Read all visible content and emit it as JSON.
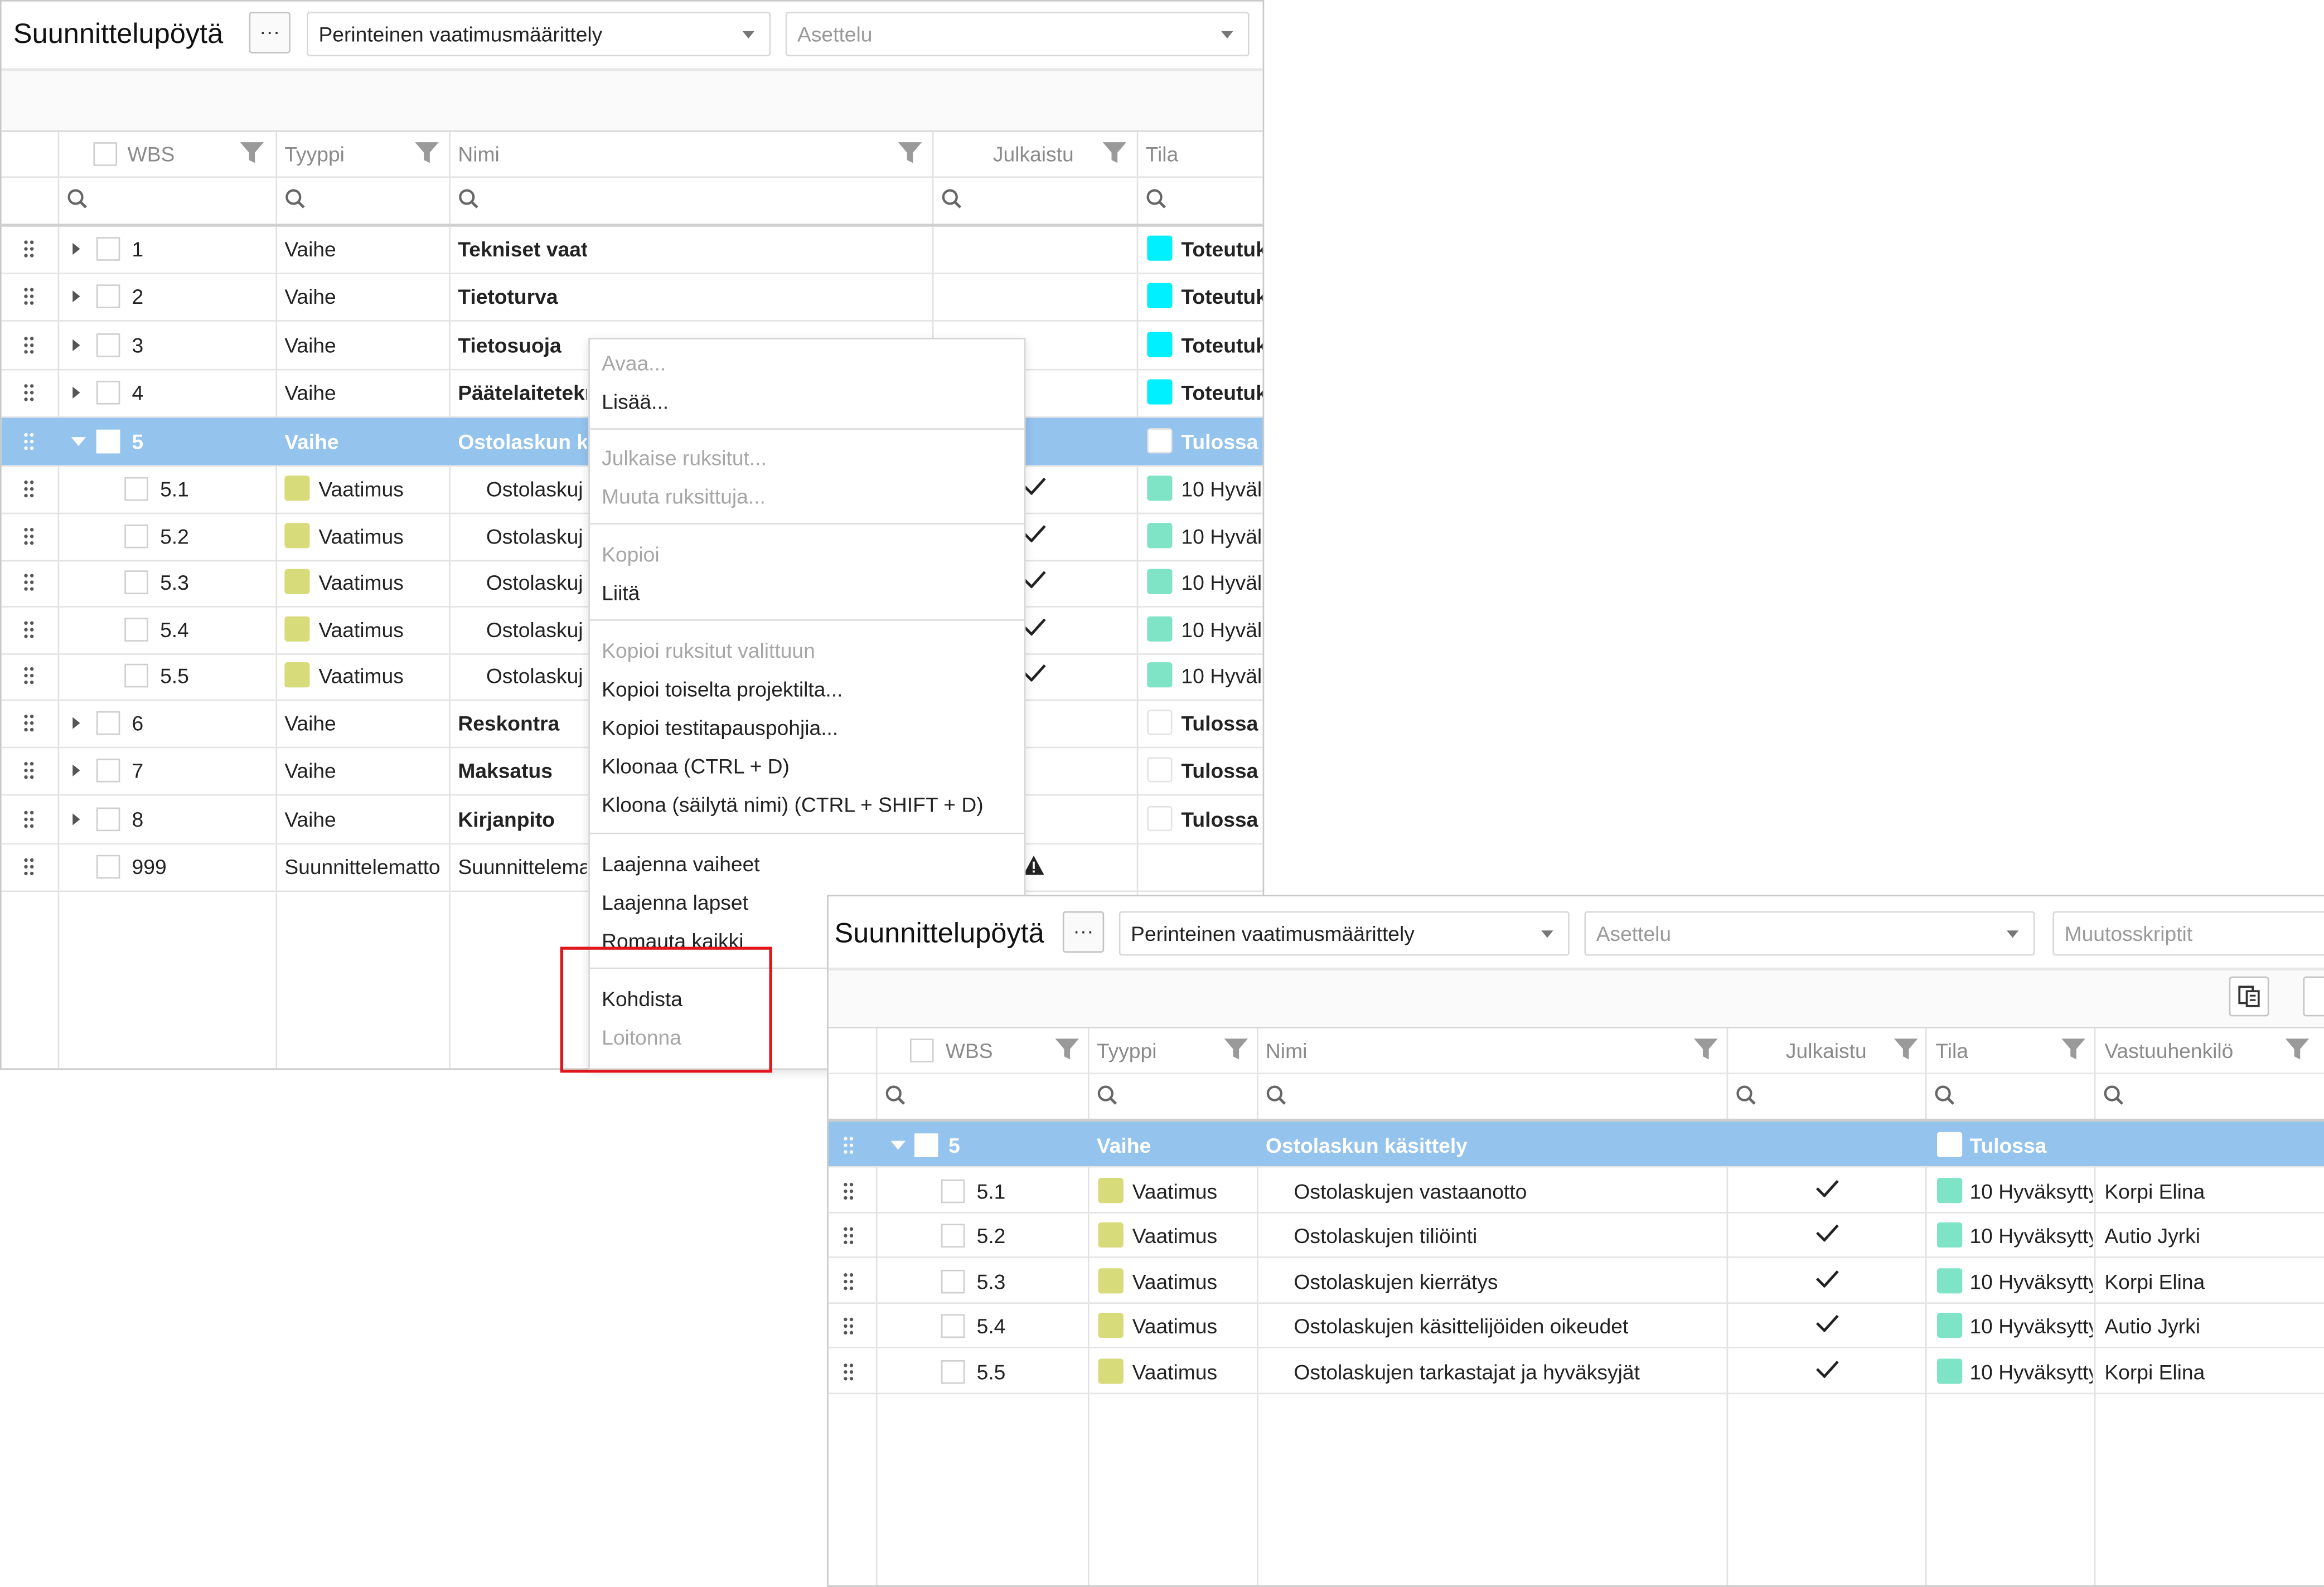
{
  "left_panel": {
    "title": "Suunnittelupöytä",
    "more_label": "···",
    "dropdown1": "Perinteinen vaatimusmäärittely",
    "dropdown2": "Asettelu",
    "columns": [
      "WBS",
      "Tyyppi",
      "Nimi",
      "Julkaistu",
      "Tila"
    ],
    "rows": [
      {
        "wbs": "1",
        "type": "Vaihe",
        "name": "Tekniset vaatimukset",
        "status": "Toteutuk"
      },
      {
        "wbs": "2",
        "type": "Vaihe",
        "name": "Tietoturva",
        "status": "Toteutuk"
      },
      {
        "wbs": "3",
        "type": "Vaihe",
        "name": "Tietosuoja",
        "status": "Toteutuk"
      },
      {
        "wbs": "4",
        "type": "Vaihe",
        "name": "Päätelaitetekr",
        "status": "Toteutuk"
      },
      {
        "wbs": "5",
        "type": "Vaihe",
        "name": "Ostolaskun kä",
        "status": "Tulossa"
      },
      {
        "wbs": "5.1",
        "type": "Vaatimus",
        "name": "Ostolaskuj",
        "status": "10 Hyväl"
      },
      {
        "wbs": "5.2",
        "type": "Vaatimus",
        "name": "Ostolaskuj",
        "status": "10 Hyväl"
      },
      {
        "wbs": "5.3",
        "type": "Vaatimus",
        "name": "Ostolaskuj",
        "status": "10 Hyväl"
      },
      {
        "wbs": "5.4",
        "type": "Vaatimus",
        "name": "Ostolaskuj",
        "status": "10 Hyväl"
      },
      {
        "wbs": "5.5",
        "type": "Vaatimus",
        "name": "Ostolaskuj",
        "status": "10 Hyväl"
      },
      {
        "wbs": "6",
        "type": "Vaihe",
        "name": "Reskontra",
        "status": "Tulossa"
      },
      {
        "wbs": "7",
        "type": "Vaihe",
        "name": "Maksatus",
        "status": "Tulossa"
      },
      {
        "wbs": "8",
        "type": "Vaihe",
        "name": "Kirjanpito",
        "status": "Tulossa"
      },
      {
        "wbs": "999",
        "type": "Suunnittelematto",
        "name": "Suunnittelema",
        "status": ""
      }
    ]
  },
  "context_menu": [
    "Avaa...",
    "Lisää...",
    "Julkaise ruksitut...",
    "Muuta ruksittuja...",
    "Kopioi",
    "Liitä",
    "Kopioi ruksitut valittuun",
    "Kopioi toiselta projektilta...",
    "Kopioi testitapauspohjia...",
    "Kloonaa (CTRL + D)",
    "Kloona (säilytä nimi) (CTRL + SHIFT + D)",
    "Laajenna vaiheet",
    "Laajenna lapset",
    "Romauta kaikki",
    "Kohdista",
    "Loitonna"
  ],
  "right_panel": {
    "title": "Suunnittelupöytä",
    "more_label": "···",
    "dropdown1": "Perinteinen vaatimusmäärittely",
    "dropdown2": "Asettelu",
    "dropdown3": "Muutosskriptit",
    "columns": [
      "WBS",
      "Tyyppi",
      "Nimi",
      "Julkaistu",
      "Tila",
      "Vastuuhenkilö"
    ],
    "rows": [
      {
        "wbs": "5",
        "type": "Vaihe",
        "name": "Ostolaskun käsittely",
        "status": "Tulossa",
        "owner": ""
      },
      {
        "wbs": "5.1",
        "type": "Vaatimus",
        "name": "Ostolaskujen vastaanotto",
        "status": "10 Hyväksytty",
        "owner": "Korpi Elina"
      },
      {
        "wbs": "5.2",
        "type": "Vaatimus",
        "name": "Ostolaskujen tiliöinti",
        "status": "10 Hyväksytty",
        "owner": "Autio Jyrki"
      },
      {
        "wbs": "5.3",
        "type": "Vaatimus",
        "name": "Ostolaskujen kierrätys",
        "status": "10 Hyväksytty",
        "owner": "Korpi Elina"
      },
      {
        "wbs": "5.4",
        "type": "Vaatimus",
        "name": "Ostolaskujen käsittelijöiden oikeudet",
        "status": "10 Hyväksytty",
        "owner": "Autio Jyrki"
      },
      {
        "wbs": "5.5",
        "type": "Vaatimus",
        "name": "Ostolaskujen tarkastajat ja hyväksyjät",
        "status": "10 Hyväksytty",
        "owner": "Korpi Elina"
      }
    ]
  },
  "colors": {
    "selected_row": "#94c3ee",
    "status_in_progress": "#00f0ff",
    "status_approved": "#7fe3c6",
    "type_requirement": "#d8db7a",
    "highlight_box": "#e0161b"
  }
}
